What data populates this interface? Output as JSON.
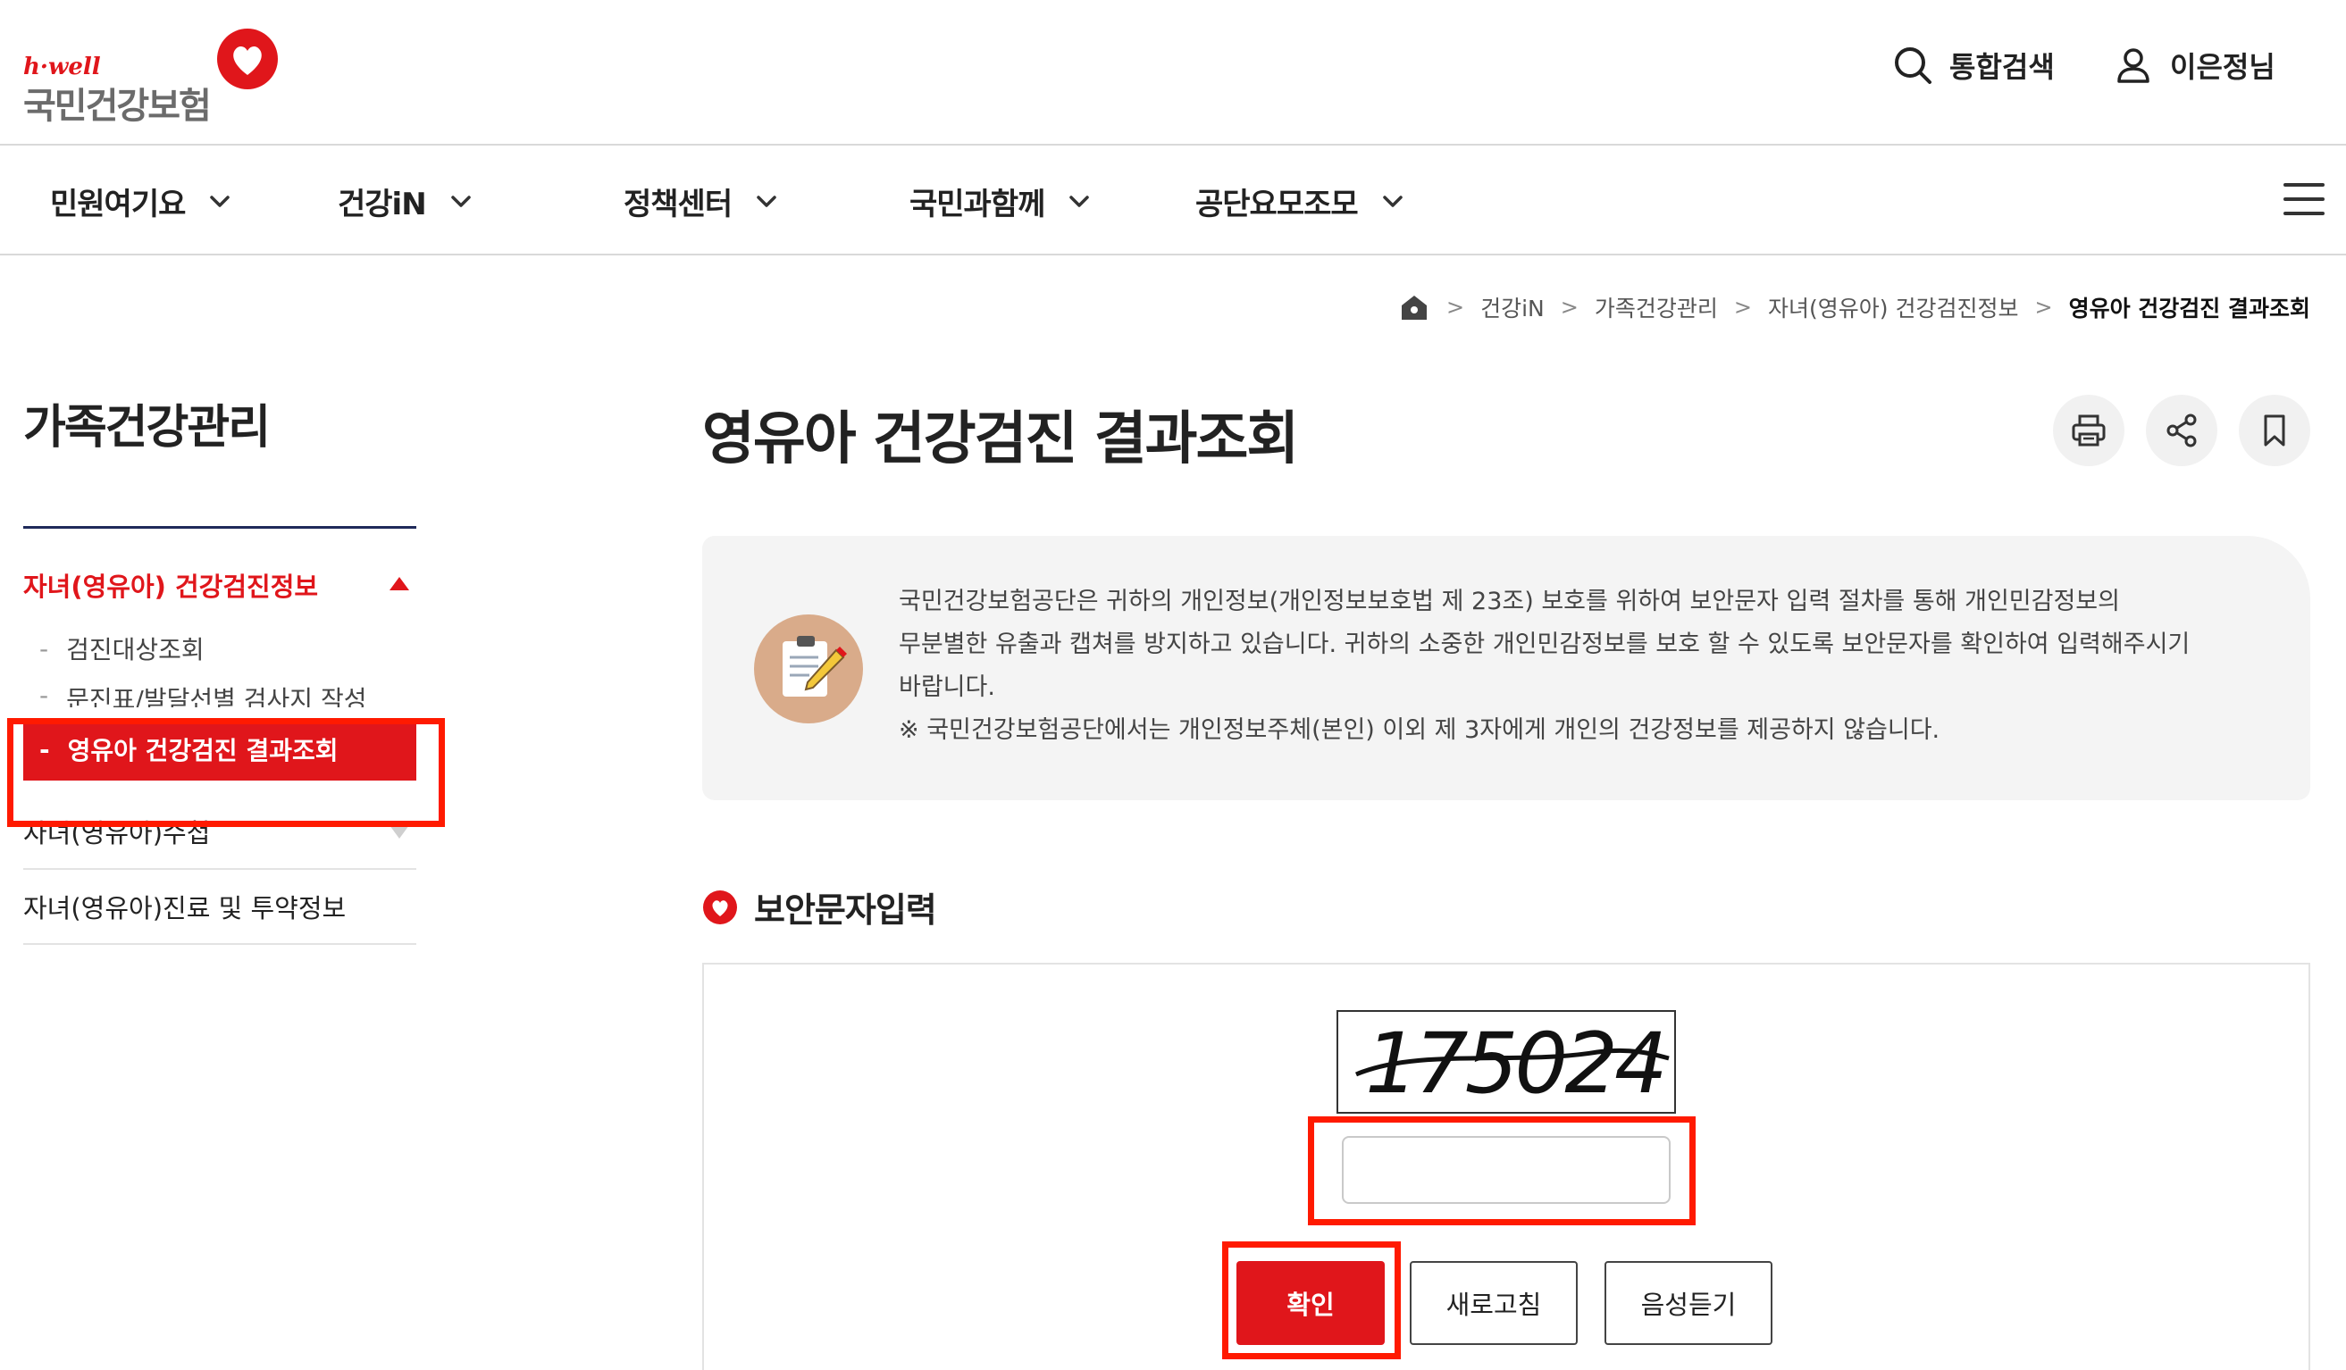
{
  "logo": {
    "tagline": "h·well",
    "name": "국민건강보험"
  },
  "header": {
    "search_label": "통합검색",
    "user_label": "이은정님"
  },
  "gnb": {
    "items": [
      {
        "label": "민원여기요"
      },
      {
        "label": "건강iN"
      },
      {
        "label": "정책센터"
      },
      {
        "label": "국민과함께"
      },
      {
        "label": "공단요모조모"
      }
    ]
  },
  "breadcrumb": [
    "건강iN",
    "가족건강관리",
    "자녀(영유아) 건강검진정보",
    "영유아 건강검진 결과조회"
  ],
  "sidebar": {
    "title": "가족건강관리",
    "group_label": "자녀(영유아) 건강검진정보",
    "sub_items": [
      "검진대상조회",
      "문진표/발달선별 검사지 작성",
      "영유아 건강검진 결과조회"
    ],
    "other_items": [
      "자녀(영유아)수첩",
      "자녀(영유아)진료 및 투약정보"
    ]
  },
  "main": {
    "title": "영유아 건강검진 결과조회",
    "notice": {
      "line1": "국민건강보험공단은 귀하의 개인정보(개인정보보호법 제 23조) 보호를 위하여 보안문자 입력 절차를 통해 개인민감정보의",
      "line2": "무분별한 유출과 캡쳐를 방지하고 있습니다. 귀하의 소중한 개인민감정보를 보호 할 수 있도록 보안문자를 확인하여 입력해주시기",
      "line3": "바랍니다.",
      "note": "※ 국민건강보험공단에서는 개인정보주체(본인) 이외 제 3자에게 개인의 건강정보를 제공하지 않습니다."
    },
    "captcha": {
      "section_title": "보안문자입력",
      "image_text": "175024",
      "input_value": "",
      "confirm_label": "확인",
      "refresh_label": "새로고침",
      "audio_label": "음성듣기"
    }
  },
  "colors": {
    "brand_red": "#e0161b",
    "highlight_box": "#ff1a00",
    "navy_line": "#1f2a5a"
  }
}
